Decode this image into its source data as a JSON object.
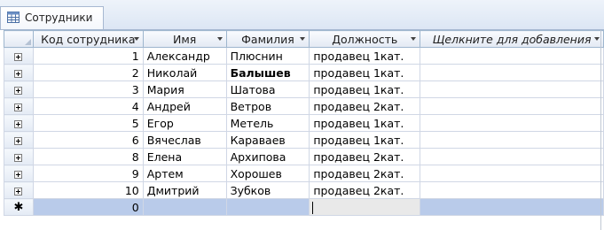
{
  "tab": {
    "title": "Сотрудники"
  },
  "columns": [
    {
      "label": "Код сотрудника"
    },
    {
      "label": "Имя"
    },
    {
      "label": "Фамилия"
    },
    {
      "label": "Должность"
    },
    {
      "label": "Щелкните для добавления"
    }
  ],
  "rows": [
    {
      "id": "1",
      "first": "Александр",
      "last": "Плюснин",
      "pos": "продавец 1кат."
    },
    {
      "id": "2",
      "first": "Николай",
      "last": "Балышев",
      "pos": "продавец 1кат."
    },
    {
      "id": "3",
      "first": "Мария",
      "last": "Шатова",
      "pos": "продавец 1кат."
    },
    {
      "id": "4",
      "first": "Андрей",
      "last": "Ветров",
      "pos": "продавец 2кат."
    },
    {
      "id": "5",
      "first": "Егор",
      "last": "Метель",
      "pos": "продавец 1кат."
    },
    {
      "id": "6",
      "first": "Вячеслав",
      "last": "Караваев",
      "pos": "продавец 1кат."
    },
    {
      "id": "8",
      "first": "Елена",
      "last": "Архипова",
      "pos": "продавец 2кат."
    },
    {
      "id": "9",
      "first": "Артем",
      "last": "Хорошев",
      "pos": "продавец 2кат."
    },
    {
      "id": "10",
      "first": "Дмитрий",
      "last": "Зубков",
      "pos": "продавец 2кат."
    }
  ],
  "new_row": {
    "marker": "✱",
    "id": "0"
  }
}
